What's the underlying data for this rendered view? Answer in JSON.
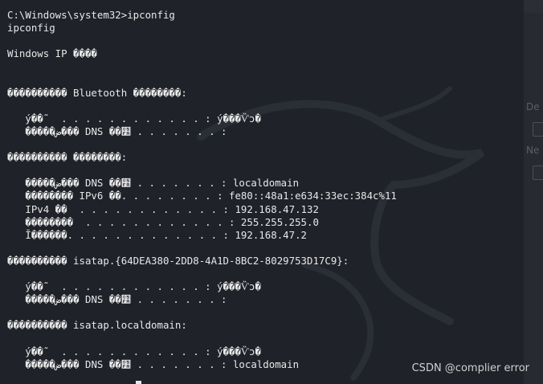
{
  "terminal": {
    "lines": [
      "C:\\Windows\\system32>ipconfig",
      "ipconfig",
      "",
      "Windows IP ����",
      "",
      "",
      "���������� Bluetooth ��������:",
      "",
      "   ý��˜  . . . . . . . . . . . . : ý���Ѷɔ�",
      "   �����ض��� DNS ��׺ . . . . . . . :",
      "",
      "���������� ��������:",
      "",
      "   �����ض��� DNS ��׺ . . . . . . . : localdomain",
      "   �������� IPv6 ��. . . . . . . . : fe80::48a1:e634:33ec:384c%11",
      "   IPv4 ��  . . . . . . . . . . . . : 192.168.47.132",
      "   ��������  . . . . . . . . . . . . : 255.255.255.0",
      "   Ĭ������. . . . . . . . . . . . . : 192.168.47.2",
      "",
      "���������� isatap.{64DEA380-2DD8-4A1D-8BC2-8029753D17C9}:",
      "",
      "   ý��˜  . . . . . . . . . . . . : ý���Ѷɔ�",
      "   �����ض��� DNS ��׺ . . . . . . . :",
      "",
      "���������� isatap.localdomain:",
      "",
      "   ý��˜  . . . . . . . . . . . . : ý���Ѷɔ�",
      "   �����ض��� DNS ��׺ . . . . . . . : localdomain"
    ]
  },
  "background_window": {
    "labels": [
      "De",
      "Ne"
    ]
  },
  "watermark_text": "CSDN @complier error",
  "colors": {
    "terminal_bg": "#1f2229",
    "text": "#e8e8e8"
  }
}
